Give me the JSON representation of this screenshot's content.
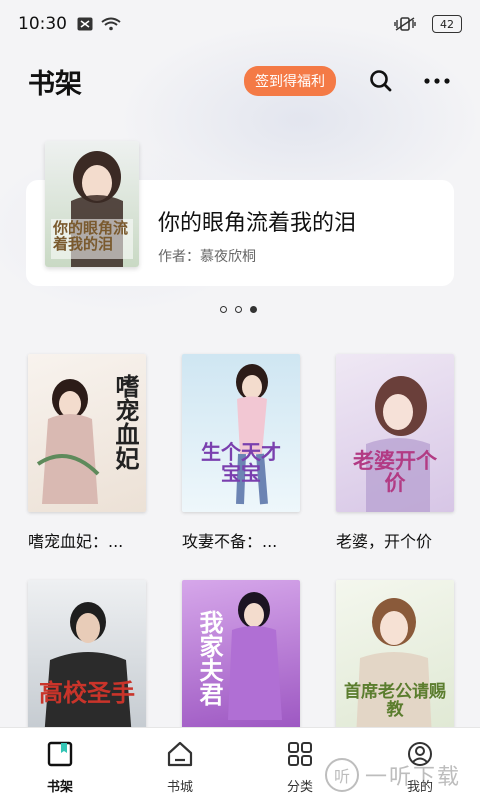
{
  "status_bar": {
    "time": "10:30",
    "battery": "42"
  },
  "header": {
    "title": "书架",
    "signin_label": "签到得福利"
  },
  "featured": {
    "title": "你的眼角流着我的泪",
    "author": "作者：慕夜欣桐",
    "cover_text": "你的眼角流着我的泪"
  },
  "carousel": {
    "count": 3,
    "active": 2
  },
  "books": [
    {
      "title": "嗜宠血妃：...",
      "cover_text": "嗜宠血妃",
      "cover_colors": [
        "#f6f1ec",
        "#b23b44"
      ]
    },
    {
      "title": "攻妻不备：...",
      "cover_text": "生个天才宝宝",
      "cover_colors": [
        "#dff0f7",
        "#7a3fae"
      ]
    },
    {
      "title": "老婆，开个价",
      "cover_text": "老婆开个价",
      "cover_colors": [
        "#e7dff0",
        "#b23b84"
      ]
    },
    {
      "title": "",
      "cover_text": "高校圣手",
      "cover_colors": [
        "#d9dde2",
        "#2a2a2a"
      ]
    },
    {
      "title": "",
      "cover_text": "我家夫君",
      "cover_colors": [
        "#c78be0",
        "#6a1f8c"
      ]
    },
    {
      "title": "",
      "cover_text": "首席老公请赐教",
      "cover_colors": [
        "#eef3e6",
        "#5b7d2e"
      ]
    }
  ],
  "tabs": [
    {
      "label": "书架",
      "icon": "bookshelf-icon",
      "active": true
    },
    {
      "label": "书城",
      "icon": "bookstore-icon",
      "active": false
    },
    {
      "label": "分类",
      "icon": "category-icon",
      "active": false
    },
    {
      "label": "我的",
      "icon": "profile-icon",
      "active": false
    }
  ],
  "watermark": {
    "text": "一听下载",
    "glyph": "听"
  },
  "colors": {
    "accent": "#f47a46",
    "background": "#f4f4f6"
  }
}
